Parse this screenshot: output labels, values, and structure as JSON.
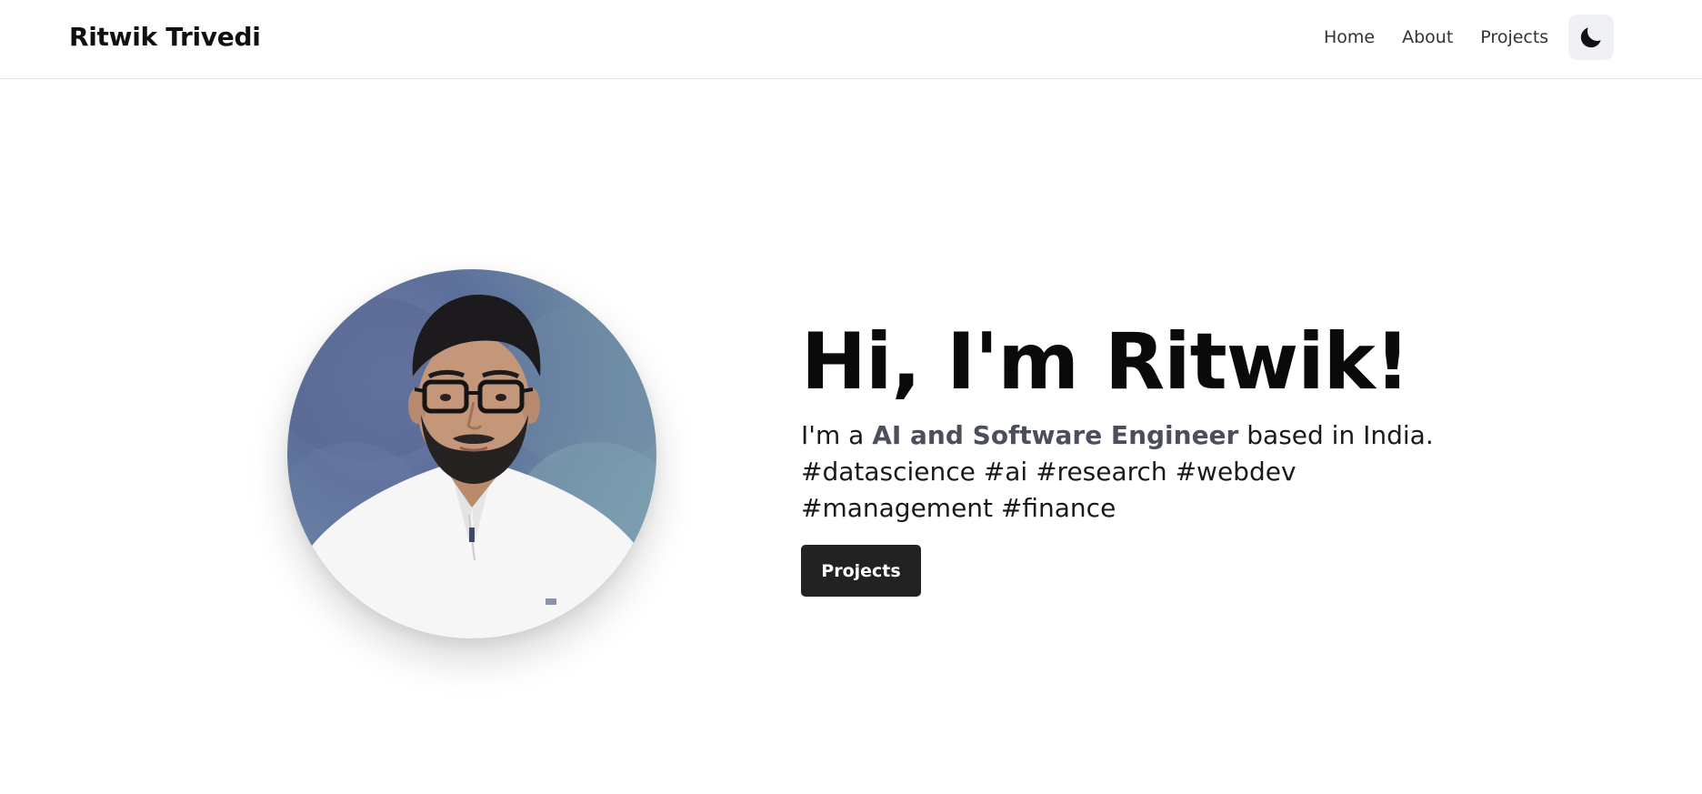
{
  "header": {
    "brand": "Ritwik Trivedi",
    "nav": [
      "Home",
      "About",
      "Projects"
    ],
    "theme_toggle_icon": "moon-icon"
  },
  "hero": {
    "photo_alt": "Ritwik Trivedi",
    "title": "Hi, I'm Ritwik!",
    "desc_prefix": "I'm a ",
    "role": "AI and Software Engineer",
    "desc_suffix": " based in India.",
    "tags_line1": "#datascience #ai #research #webdev",
    "tags_line2": "#management #finance",
    "cta_label": "Projects"
  },
  "colors": {
    "accent_text": "#4b4f5c",
    "button_bg": "#222222",
    "toggle_bg": "#eef0f5"
  }
}
